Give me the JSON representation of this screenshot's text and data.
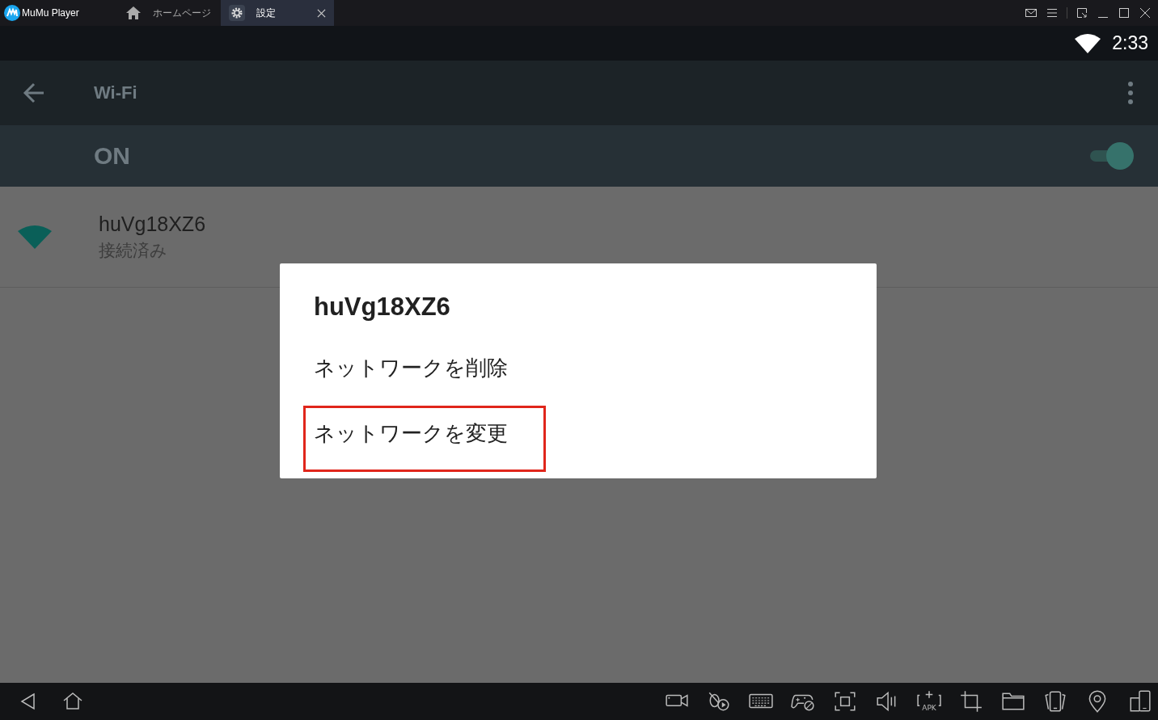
{
  "titlebar": {
    "app_name": "MuMu Player",
    "tabs": [
      {
        "label": "ホームページ",
        "kind": "home",
        "selected": false,
        "closable": false
      },
      {
        "label": "設定",
        "kind": "gear",
        "selected": true,
        "closable": true
      }
    ]
  },
  "status_bar": {
    "time": "2:33"
  },
  "app_bar": {
    "title": "Wi-Fi"
  },
  "switch_bar": {
    "label": "ON",
    "on": true
  },
  "networks": [
    {
      "name": "huVg18XZ6",
      "status": "接続済み"
    }
  ],
  "dialog": {
    "title": "huVg18XZ6",
    "options": [
      {
        "label": "ネットワークを削除",
        "highlighted": false
      },
      {
        "label": "ネットワークを変更",
        "highlighted": true
      }
    ]
  },
  "toolbar": [
    {
      "kind": "video"
    },
    {
      "kind": "macro"
    },
    {
      "kind": "keyboard"
    },
    {
      "kind": "gamepad"
    },
    {
      "kind": "screenshot"
    },
    {
      "kind": "volume"
    },
    {
      "kind": "apk",
      "label": "APK"
    },
    {
      "kind": "crop"
    },
    {
      "kind": "folder"
    },
    {
      "kind": "shake"
    },
    {
      "kind": "location"
    },
    {
      "kind": "multi"
    }
  ]
}
